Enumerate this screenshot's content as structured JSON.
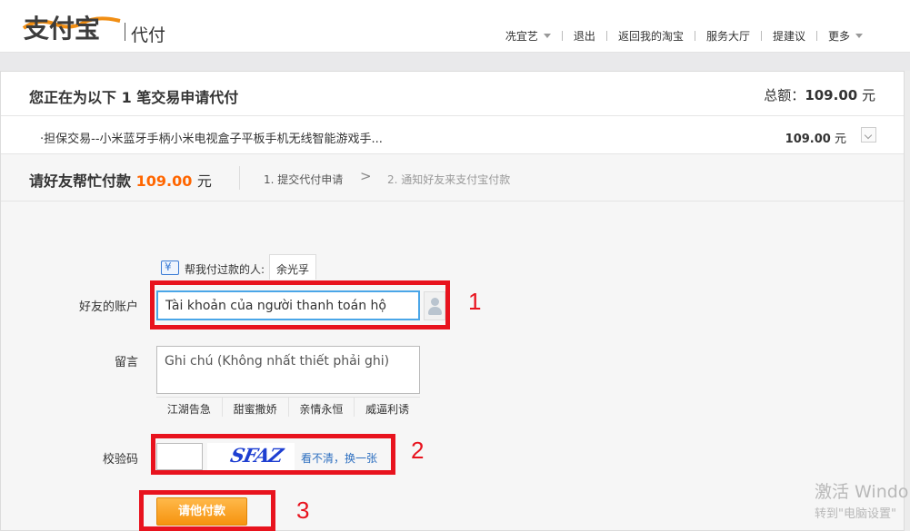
{
  "header": {
    "logo_text": "支付宝",
    "subtitle": "代付",
    "nav": [
      {
        "label": "冼宜艺",
        "dropdown": true
      },
      {
        "label": "退出",
        "dropdown": false
      },
      {
        "label": "返回我的淘宝",
        "dropdown": false
      },
      {
        "label": "服务大厅",
        "dropdown": false
      },
      {
        "label": "提建议",
        "dropdown": false
      },
      {
        "label": "更多",
        "dropdown": true
      }
    ]
  },
  "order": {
    "title": "您正在为以下 1 笔交易申请代付",
    "total_label": "总额：",
    "total_amount": "109.00",
    "total_unit": "元",
    "item_name": "·担保交易--小米蓝牙手柄小米电视盒子平板手机无线智能游戏手...",
    "item_amount": "109.00",
    "item_unit": "元"
  },
  "steps": {
    "ask_prefix": "请好友帮忙付款",
    "ask_amount": "109.00",
    "ask_unit": "元",
    "step1": "1. 提交代付申请",
    "arrow": ">",
    "step2": "2. 通知好友来支付宝付款"
  },
  "form": {
    "helped_label": "帮我付过款的人:",
    "helped_name": "余光孚",
    "account_label": "好友的账户",
    "account_value": "Tài khoản của người thanh toán hộ",
    "note_label": "留言",
    "note_value": "Ghi chú (Không nhất thiết phải ghi)",
    "quick_phrases": [
      "江湖告急",
      "甜蜜撒娇",
      "亲情永恒",
      "威逼利诱"
    ],
    "captcha_label": "校验码",
    "captcha_text": "SFAZ",
    "captcha_refresh": "看不清，换一张",
    "pay_button": "请他付款"
  },
  "annotations": {
    "n1": "1",
    "n2": "2",
    "n3": "3",
    "color": "#e8131e"
  },
  "watermark": {
    "line1": "激活 Windo",
    "line2": "转到\"电脑设置\""
  },
  "colors": {
    "brand_orange": "#f6930f",
    "amount_orange": "#ff6600",
    "input_focus": "#4aa6e8",
    "link_blue": "#2d6fc0"
  }
}
